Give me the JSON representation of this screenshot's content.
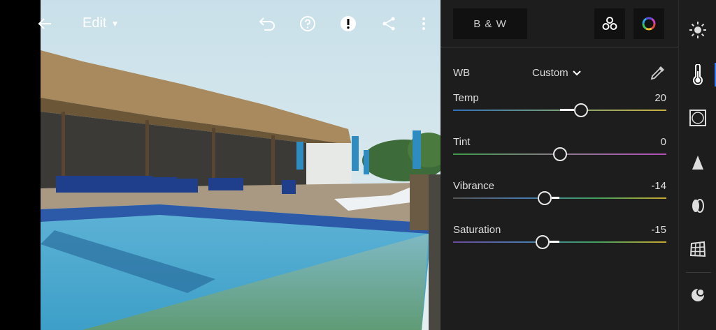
{
  "toolbar": {
    "edit_label": "Edit"
  },
  "panel": {
    "bw_label": "B & W",
    "wb": {
      "label": "WB",
      "value": "Custom"
    },
    "sliders": {
      "temp": {
        "label": "Temp",
        "value": "20",
        "position": 0.6
      },
      "tint": {
        "label": "Tint",
        "value": "0",
        "position": 0.5
      },
      "vibrance": {
        "label": "Vibrance",
        "value": "-14",
        "position": 0.43
      },
      "saturation": {
        "label": "Saturation",
        "value": "-15",
        "position": 0.42
      }
    }
  },
  "colors": {
    "panel_bg": "#1d1d1d",
    "active_accent": "#2e7cf6"
  },
  "rail_icons": [
    "light-icon",
    "color-temperature-icon",
    "effects-icon",
    "detail-icon",
    "optics-icon",
    "geometry-icon",
    "selective-icon"
  ]
}
